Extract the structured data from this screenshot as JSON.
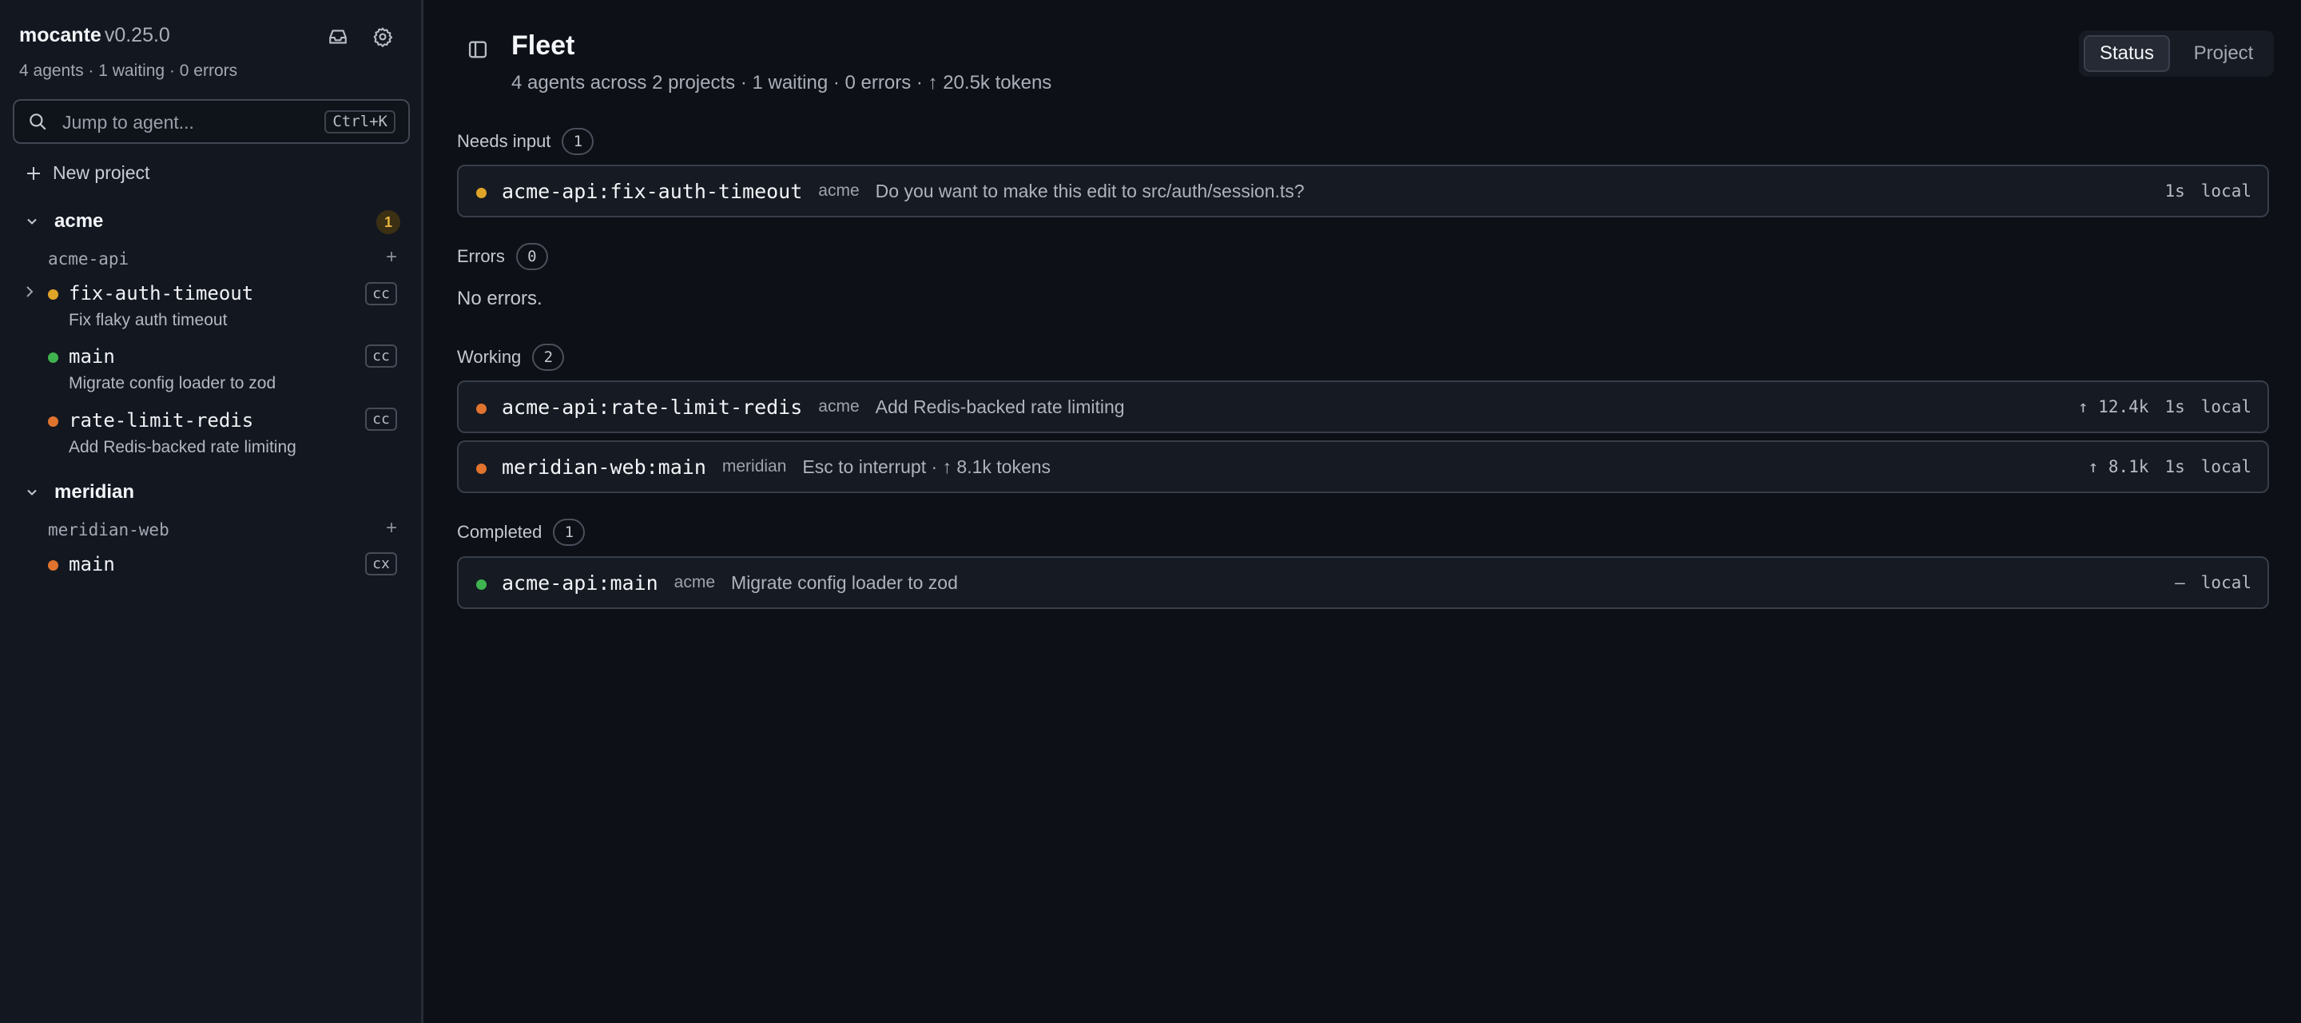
{
  "app": {
    "name": "mocante",
    "version": "v0.25.0"
  },
  "sidebar": {
    "summary": "4 agents · 1 waiting · 0 errors",
    "search": {
      "placeholder": "Jump to agent...",
      "shortcut": "Ctrl+K"
    },
    "new_project_label": "New project",
    "projects": [
      {
        "name": "acme",
        "badge": "1",
        "repos": [
          {
            "name": "acme-api",
            "branches": [
              {
                "title": "fix-auth-timeout",
                "desc": "Fix flaky auth timeout",
                "tag": "cc",
                "status": "waiting"
              },
              {
                "title": "main",
                "desc": "Migrate config loader to zod",
                "tag": "cc",
                "status": "done"
              },
              {
                "title": "rate-limit-redis",
                "desc": "Add Redis-backed rate limiting",
                "tag": "cc",
                "status": "working"
              }
            ]
          }
        ]
      },
      {
        "name": "meridian",
        "repos": [
          {
            "name": "meridian-web",
            "branches": [
              {
                "title": "main",
                "tag": "cx",
                "status": "working"
              }
            ]
          }
        ]
      }
    ]
  },
  "main": {
    "title": "Fleet",
    "subtitle": "4 agents across 2 projects · 1 waiting · 0 errors · ↑ 20.5k tokens",
    "view_toggle": {
      "options": [
        "Status",
        "Project"
      ],
      "selected": "Status"
    },
    "sections": [
      {
        "label": "Needs input",
        "count": "1",
        "items": [
          {
            "agent": "acme-api:fix-auth-timeout",
            "project": "acme",
            "message": "Do you want to make this edit to src/auth/session.ts?",
            "tokens": "",
            "time": "1s",
            "host": "local",
            "status": "waiting"
          }
        ]
      },
      {
        "label": "Errors",
        "count": "0",
        "empty_text": "No errors.",
        "items": []
      },
      {
        "label": "Working",
        "count": "2",
        "items": [
          {
            "agent": "acme-api:rate-limit-redis",
            "project": "acme",
            "message": "Add Redis-backed rate limiting",
            "tokens": "↑ 12.4k",
            "time": "1s",
            "host": "local",
            "status": "working"
          },
          {
            "agent": "meridian-web:main",
            "project": "meridian",
            "message": "Esc to interrupt · ↑ 8.1k tokens",
            "tokens": "↑ 8.1k",
            "time": "1s",
            "host": "local",
            "status": "working"
          }
        ]
      },
      {
        "label": "Completed",
        "count": "1",
        "items": [
          {
            "agent": "acme-api:main",
            "project": "acme",
            "message": "Migrate config loader to zod",
            "tokens": "",
            "time": "—",
            "host": "local",
            "status": "done"
          }
        ]
      }
    ]
  },
  "colors": {
    "waiting": "#e0a528",
    "working": "#e0742e",
    "done": "#3fb34f",
    "background": "#0d1016",
    "sidebar": "#131720"
  },
  "icons": {
    "sidebar": [
      "inbox-icon",
      "gear-icon",
      "search-icon",
      "plus-icon",
      "chevron-down-icon",
      "chevron-right-icon"
    ],
    "main": [
      "sidebar-toggle-icon"
    ]
  }
}
